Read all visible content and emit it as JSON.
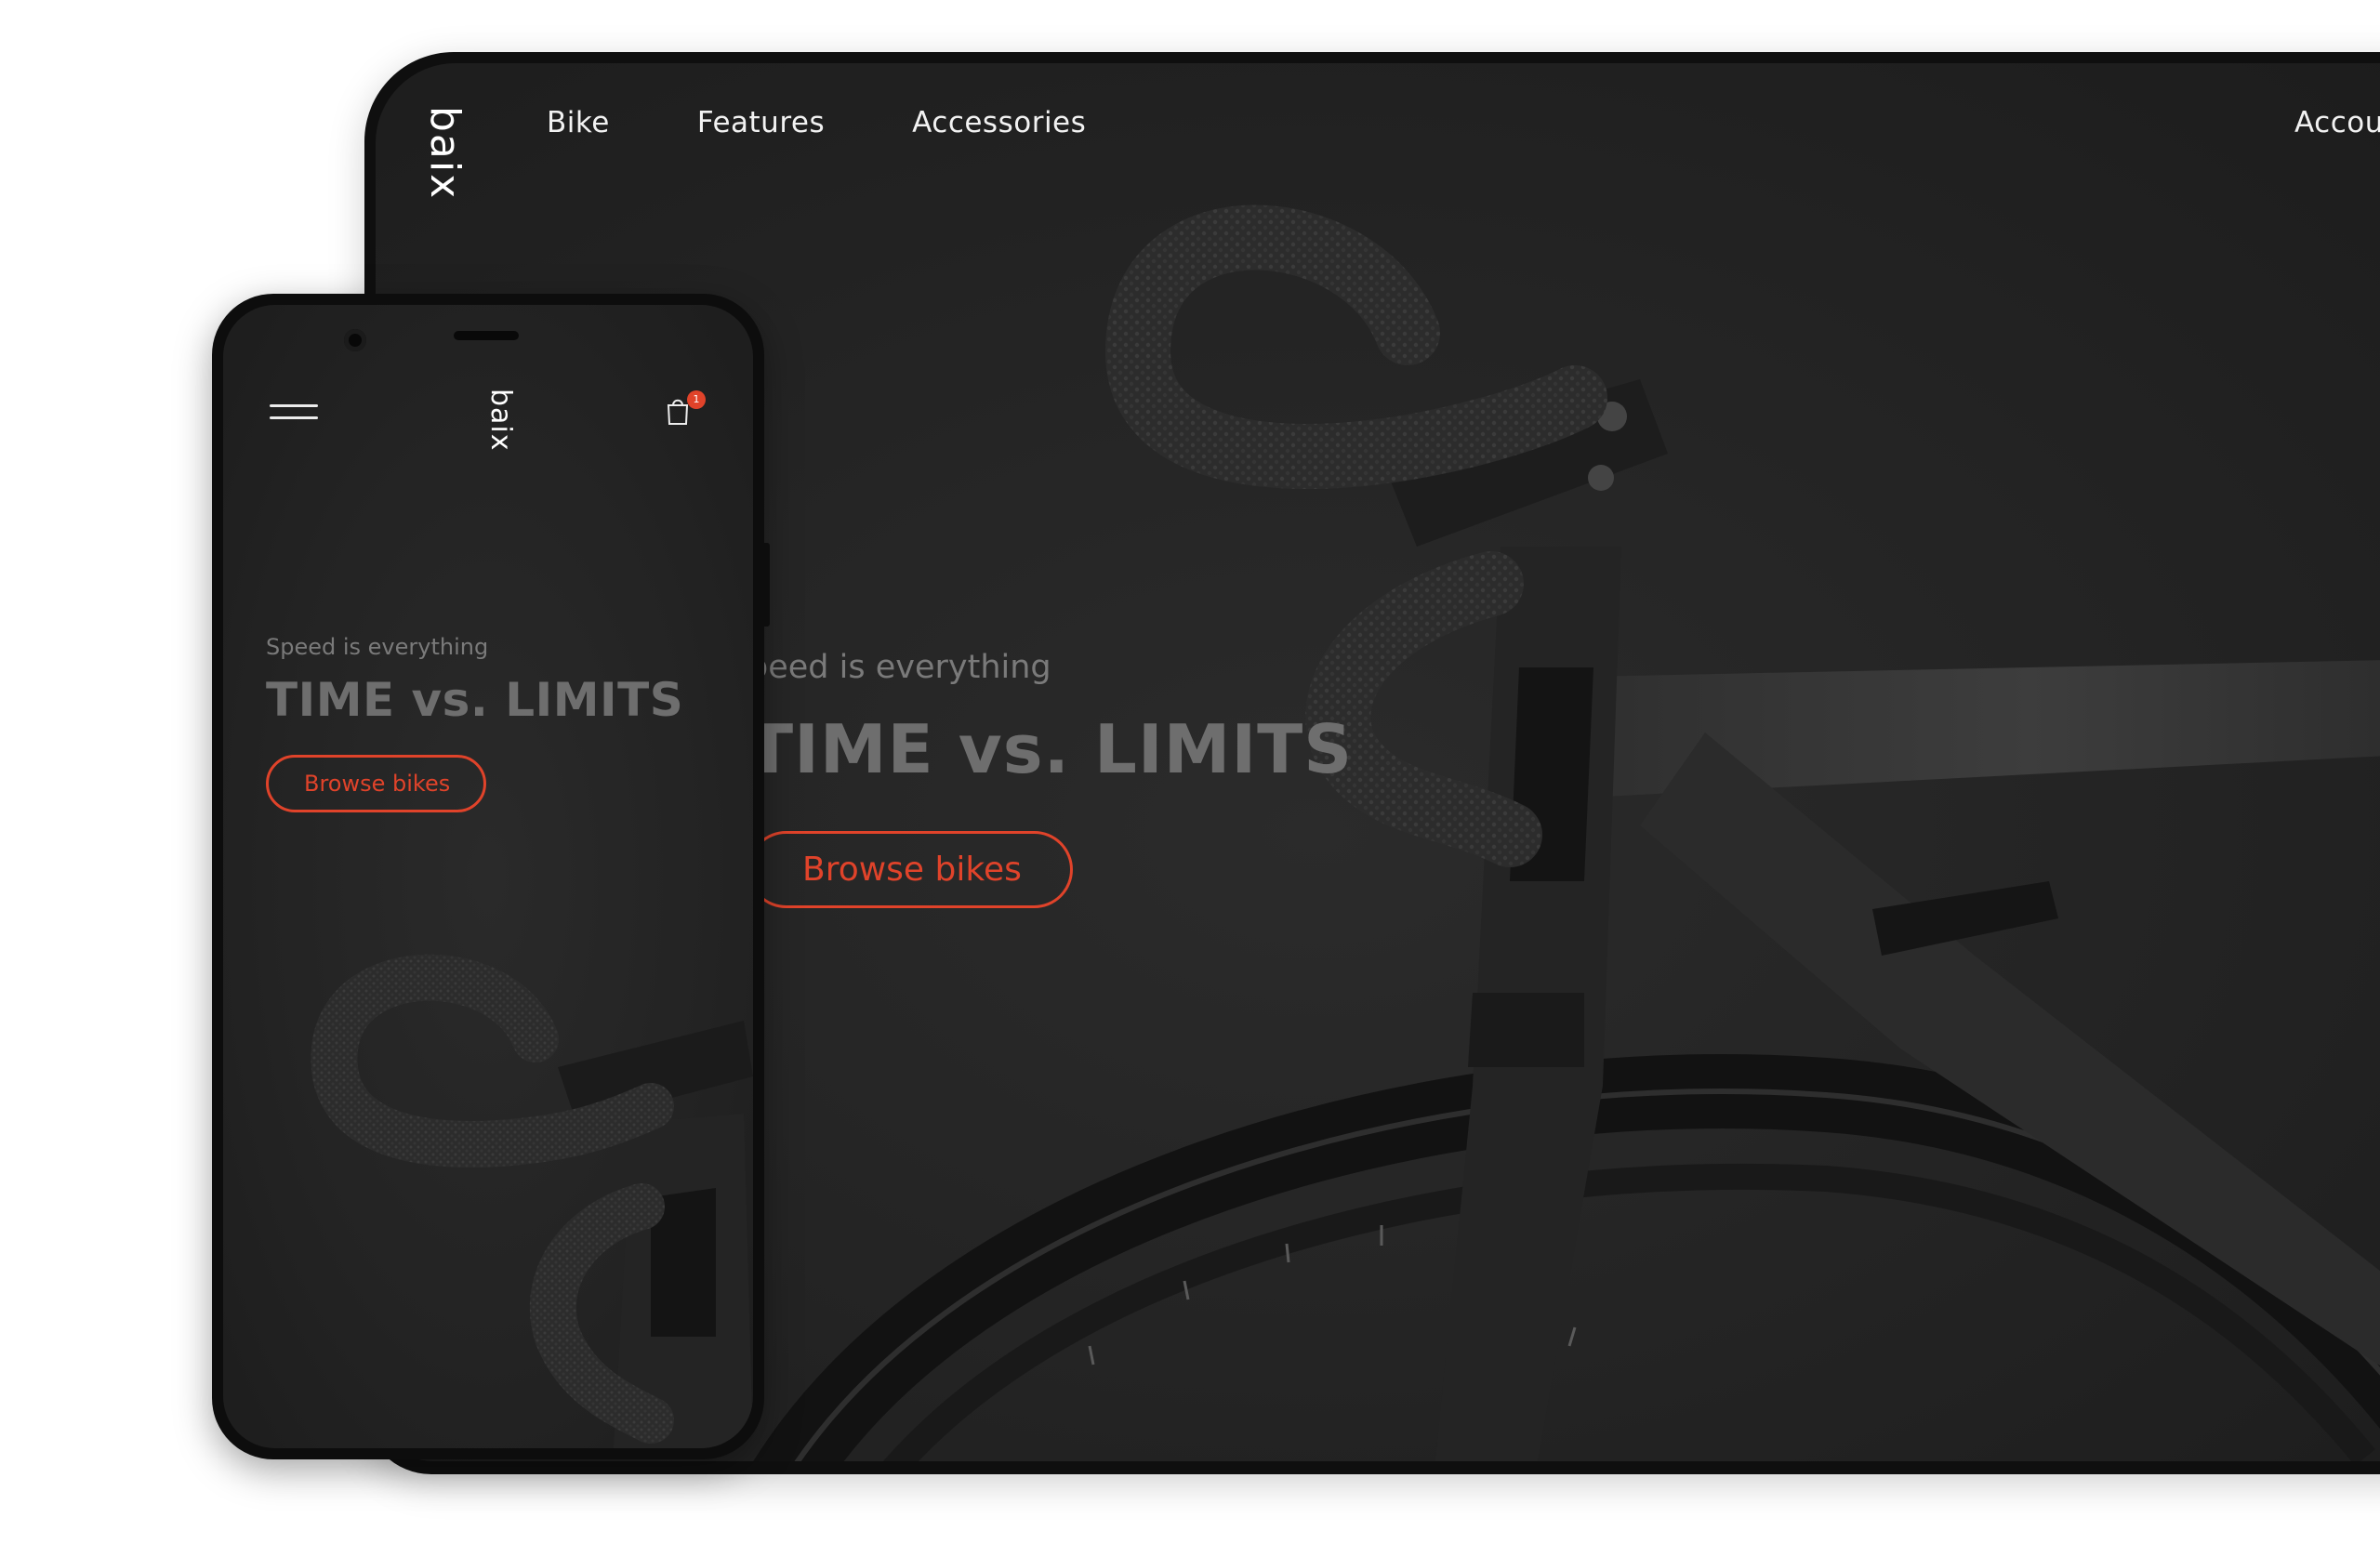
{
  "desktop": {
    "logo": "baix",
    "nav": {
      "items": [
        {
          "label": "Bike"
        },
        {
          "label": "Features"
        },
        {
          "label": "Accessories"
        }
      ],
      "account_label": "Accou"
    },
    "hero": {
      "subtitle": "peed is everything",
      "title": "TIME vs. LIMITS",
      "cta_label": "Browse bikes"
    }
  },
  "mobile": {
    "logo": "baix",
    "cart_count": "1",
    "hero": {
      "subtitle": "Speed is everything",
      "title": "TIME vs. LIMITS",
      "cta_label": "Browse bikes"
    }
  },
  "colors": {
    "accent": "#e0432a",
    "background": "#232323",
    "text": "#ffffff",
    "muted_text": "#7a7a7a",
    "device_frame": "#0f0f0f"
  },
  "icons": [
    "hamburger-menu-icon",
    "shopping-bag-icon",
    "camera-icon"
  ]
}
